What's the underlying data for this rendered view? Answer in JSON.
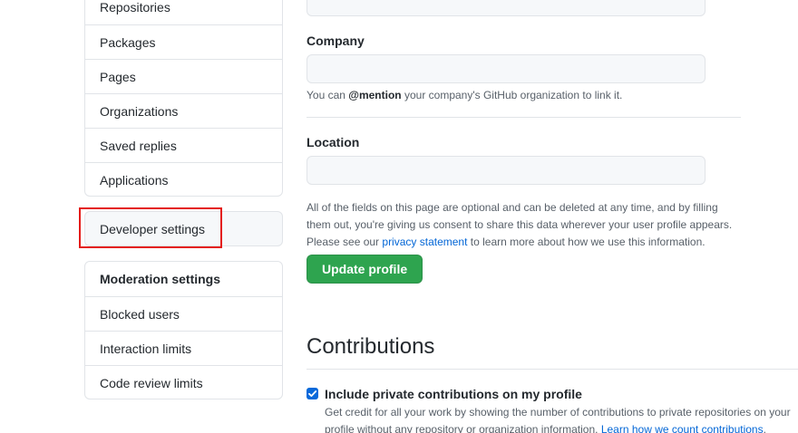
{
  "sidebar": {
    "top_items": [
      {
        "label": "Repositories"
      },
      {
        "label": "Packages"
      },
      {
        "label": "Pages"
      },
      {
        "label": "Organizations"
      },
      {
        "label": "Saved replies"
      },
      {
        "label": "Applications"
      }
    ],
    "developer_settings": "Developer settings",
    "moderation": {
      "heading": "Moderation settings",
      "items": [
        {
          "label": "Blocked users"
        },
        {
          "label": "Interaction limits"
        },
        {
          "label": "Code review limits"
        }
      ]
    }
  },
  "form": {
    "company": {
      "label": "Company",
      "value": "",
      "note_prefix": "You can ",
      "note_mention": "@mention",
      "note_suffix": " your company's GitHub organization to link it."
    },
    "location": {
      "label": "Location",
      "value": ""
    },
    "disclaimer": {
      "text_before": "All of the fields on this page are optional and can be deleted at any time, and by filling them out, you're giving us consent to share this data wherever your user profile appears. Please see our ",
      "link": "privacy statement",
      "text_after": " to learn more about how we use this information."
    },
    "update_button": "Update profile"
  },
  "contributions": {
    "title": "Contributions",
    "checkbox_checked": true,
    "checkbox_label": "Include private contributions on my profile",
    "note_before": "Get credit for all your work by showing the number of contributions to private repositories on your profile without any repository or organization information. ",
    "note_link": "Learn how we count contributions",
    "note_after": "."
  },
  "colors": {
    "primary_button": "#2ea44f",
    "link": "#0366d6",
    "highlight": "#e41b17",
    "checkbox": "#0969da"
  }
}
